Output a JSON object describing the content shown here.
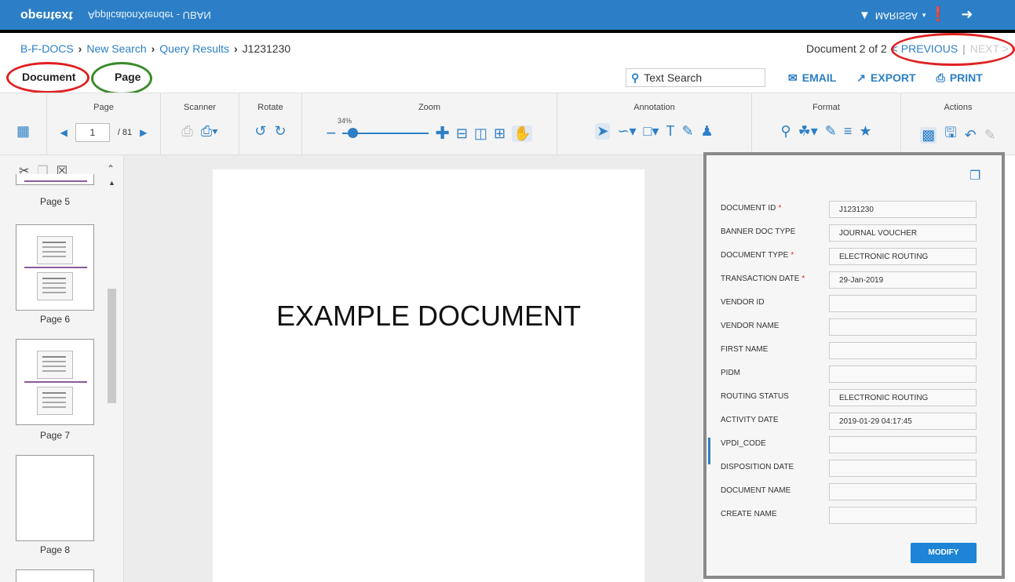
{
  "app": {
    "brand": "opentext",
    "subtitle": "ApplicationXtender - UBAN",
    "user": "MARISSA",
    "user_icon": "funnel-icon"
  },
  "breadcrumb": {
    "items": [
      "B-F-DOCS",
      "New Search",
      "Query Results"
    ],
    "current": "J1231230"
  },
  "doc_nav": {
    "position": "Document 2 of 2",
    "previous": "< PREVIOUS",
    "separator": "|",
    "next": "NEXT >"
  },
  "tabs": {
    "document": "Document",
    "page": "Page"
  },
  "search": {
    "text_search": "Text Search"
  },
  "top_actions": {
    "email": "EMAIL",
    "export": "EXPORT",
    "print": "PRINT"
  },
  "toolbar": {
    "groups": {
      "page": "Page",
      "scanner": "Scanner",
      "rotate": "Rotate",
      "zoom": "Zoom",
      "annotation": "Annotation",
      "format": "Format",
      "actions": "Actions"
    },
    "page_value": "1",
    "page_total": "/ 81",
    "zoom_percent": "34%",
    "zoom_level": 0.34
  },
  "thumbnails": [
    {
      "label": "Page 5"
    },
    {
      "label": "Page 6"
    },
    {
      "label": "Page 7"
    },
    {
      "label": "Page 8"
    }
  ],
  "document": {
    "text": "EXAMPLE DOCUMENT"
  },
  "index_fields": [
    {
      "label": "DOCUMENT ID",
      "required": "*",
      "value": "J1231230"
    },
    {
      "label": "BANNER DOC TYPE",
      "required": "",
      "value": "JOURNAL VOUCHER"
    },
    {
      "label": "DOCUMENT TYPE",
      "required": "*",
      "value": "ELECTRONIC ROUTING"
    },
    {
      "label": "TRANSACTION DATE",
      "required": "*",
      "value": "29-Jan-2019"
    },
    {
      "label": "VENDOR ID",
      "required": "",
      "value": ""
    },
    {
      "label": "VENDOR NAME",
      "required": "",
      "value": ""
    },
    {
      "label": "FIRST NAME",
      "required": "",
      "value": ""
    },
    {
      "label": "PIDM",
      "required": "",
      "value": ""
    },
    {
      "label": "ROUTING STATUS",
      "required": "",
      "value": "ELECTRONIC ROUTING"
    },
    {
      "label": "ACTIVITY DATE",
      "required": "",
      "value": "2019-01-29 04:17:45"
    },
    {
      "label": "VPDI_CODE",
      "required": "",
      "value": ""
    },
    {
      "label": "DISPOSITION DATE",
      "required": "",
      "value": ""
    },
    {
      "label": "DOCUMENT NAME",
      "required": "",
      "value": ""
    },
    {
      "label": "CREATE NAME",
      "required": "",
      "value": ""
    }
  ],
  "panel": {
    "modify": "MODIFY"
  },
  "colors": {
    "accent": "#2c7fc6",
    "annotation_red": "#e02020",
    "annotation_green": "#3a8a2a"
  }
}
